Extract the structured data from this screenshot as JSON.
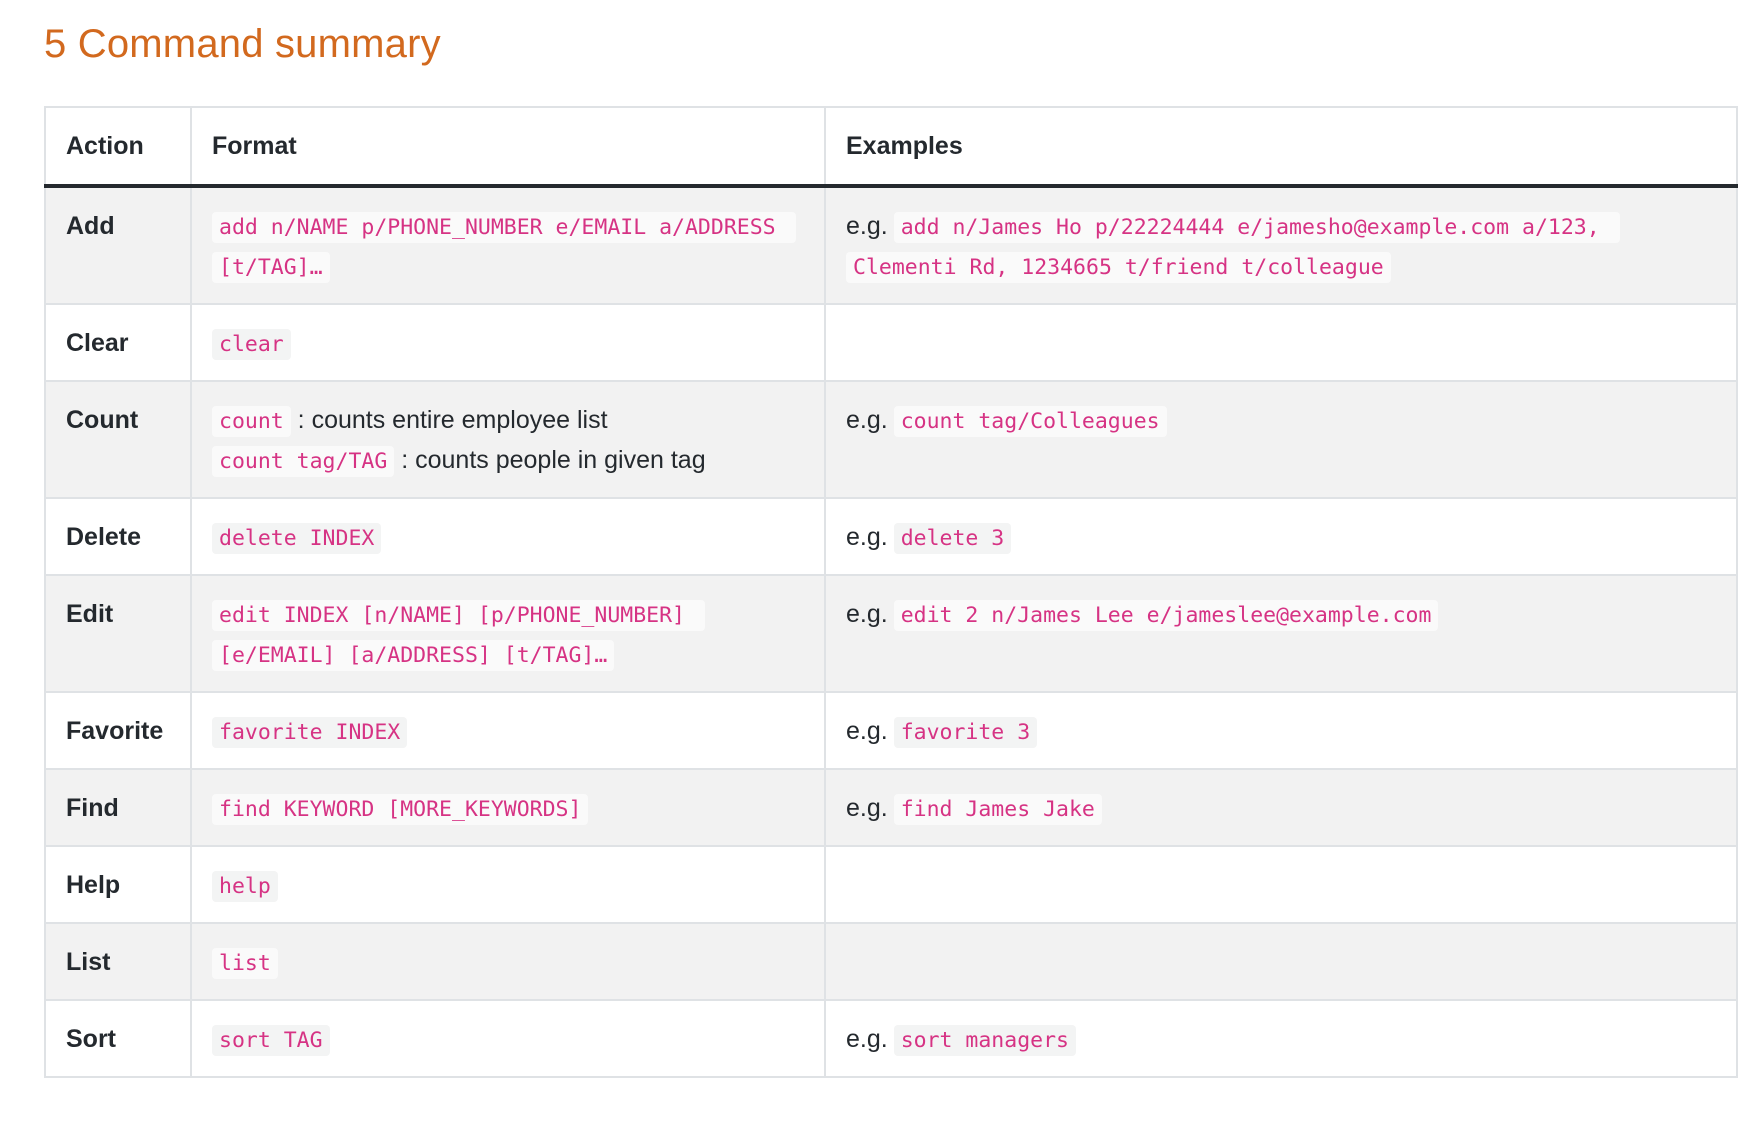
{
  "section": {
    "title": "5 Command summary"
  },
  "table": {
    "headers": {
      "action": "Action",
      "format": "Format",
      "examples": "Examples"
    },
    "eg_prefix": "e.g.",
    "rows": {
      "add": {
        "action": "Add",
        "format": "add n/NAME p/PHONE_NUMBER e/EMAIL a/ADDRESS [t/TAG]…",
        "example": "add n/James Ho p/22224444 e/jamesho@example.com a/123, Clementi Rd, 1234665 t/friend t/colleague"
      },
      "clear": {
        "action": "Clear",
        "format": "clear"
      },
      "count": {
        "action": "Count",
        "format_line1_code": "count",
        "format_line1_desc": " : counts entire employee list",
        "format_line2_code": "count tag/TAG",
        "format_line2_desc": " : counts people in given tag",
        "example": "count tag/Colleagues"
      },
      "delete": {
        "action": "Delete",
        "format": "delete INDEX",
        "example": "delete 3"
      },
      "edit": {
        "action": "Edit",
        "format": "edit INDEX [n/NAME] [p/PHONE_NUMBER] [e/EMAIL] [a/ADDRESS] [t/TAG]…",
        "example": "edit 2 n/James Lee e/jameslee@example.com"
      },
      "favorite": {
        "action": "Favorite",
        "format": "favorite INDEX",
        "example": "favorite 3"
      },
      "find": {
        "action": "Find",
        "format": "find KEYWORD [MORE_KEYWORDS]",
        "example": "find James Jake"
      },
      "help": {
        "action": "Help",
        "format": "help"
      },
      "list": {
        "action": "List",
        "format": "list"
      },
      "sort": {
        "action": "Sort",
        "format": "sort TAG",
        "example": "sort managers"
      }
    }
  },
  "colors": {
    "heading": "#d2691e",
    "code_text": "#d63384",
    "row_stripe": "#f2f2f2",
    "border": "#dfe2e5"
  }
}
